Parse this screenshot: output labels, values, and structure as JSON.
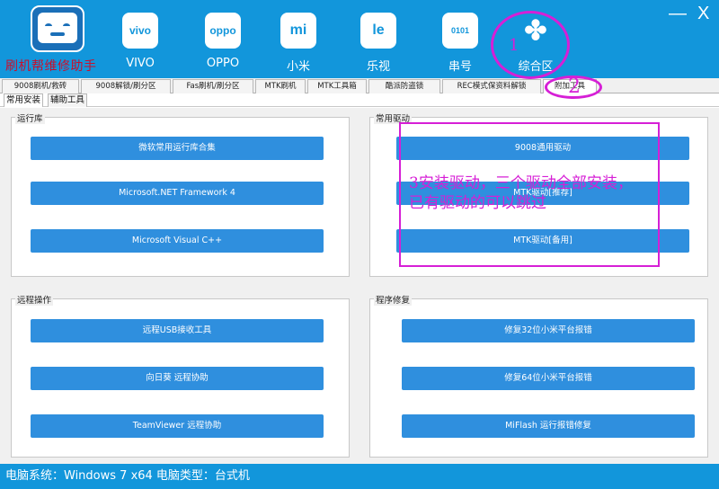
{
  "header": {
    "app_title": "刷机帮维修助手",
    "brands": [
      {
        "label": "VIVO",
        "icon_text": "vivo"
      },
      {
        "label": "OPPO",
        "icon_text": "oppo"
      },
      {
        "label": "小米",
        "icon_text": "mi"
      },
      {
        "label": "乐视",
        "icon_text": "le"
      },
      {
        "label": "串号",
        "icon_text": "0101"
      },
      {
        "label": "综合区",
        "icon_text": "✤"
      }
    ],
    "minimize": "—",
    "close": "X"
  },
  "tabs_main": [
    "9008刷机/救砖",
    "9008解锁/刷分区",
    "Fas刷机/刷分区",
    "MTK刷机",
    "MTK工具箱",
    "酷派防盗锁",
    "REC模式保资料解锁",
    "附加工具"
  ],
  "tabs_sub": [
    "常用安装",
    "辅助工具"
  ],
  "groups": {
    "runtime": {
      "title": "运行库",
      "buttons": [
        "微软常用运行库合集",
        "Microsoft.NET Framework 4",
        "Microsoft Visual C++"
      ]
    },
    "drivers": {
      "title": "常用驱动",
      "buttons": [
        "9008通用驱动",
        "MTK驱动[推荐]",
        "MTK驱动[备用]"
      ]
    },
    "remote": {
      "title": "远程操作",
      "buttons": [
        "远程USB接收工具",
        "向日葵 远程协助",
        "TeamViewer 远程协助"
      ]
    },
    "repair": {
      "title": "程序修复",
      "buttons": [
        "修复32位小米平台报错",
        "修复64位小米平台报错",
        "MiFlash 运行报错修复"
      ]
    }
  },
  "status": {
    "text": "电脑系统：Windows 7 x64 电脑类型：台式机"
  },
  "annotations": {
    "step1": "1",
    "step2": "2",
    "step3_line1": "3安装驱动，三个驱动全部安装，",
    "step3_line2": "已有驱动的可以跳过",
    "color": "#d61fd6"
  },
  "colors": {
    "header": "#1296db",
    "button": "#2f8fde",
    "logo_text": "#c8102e"
  }
}
